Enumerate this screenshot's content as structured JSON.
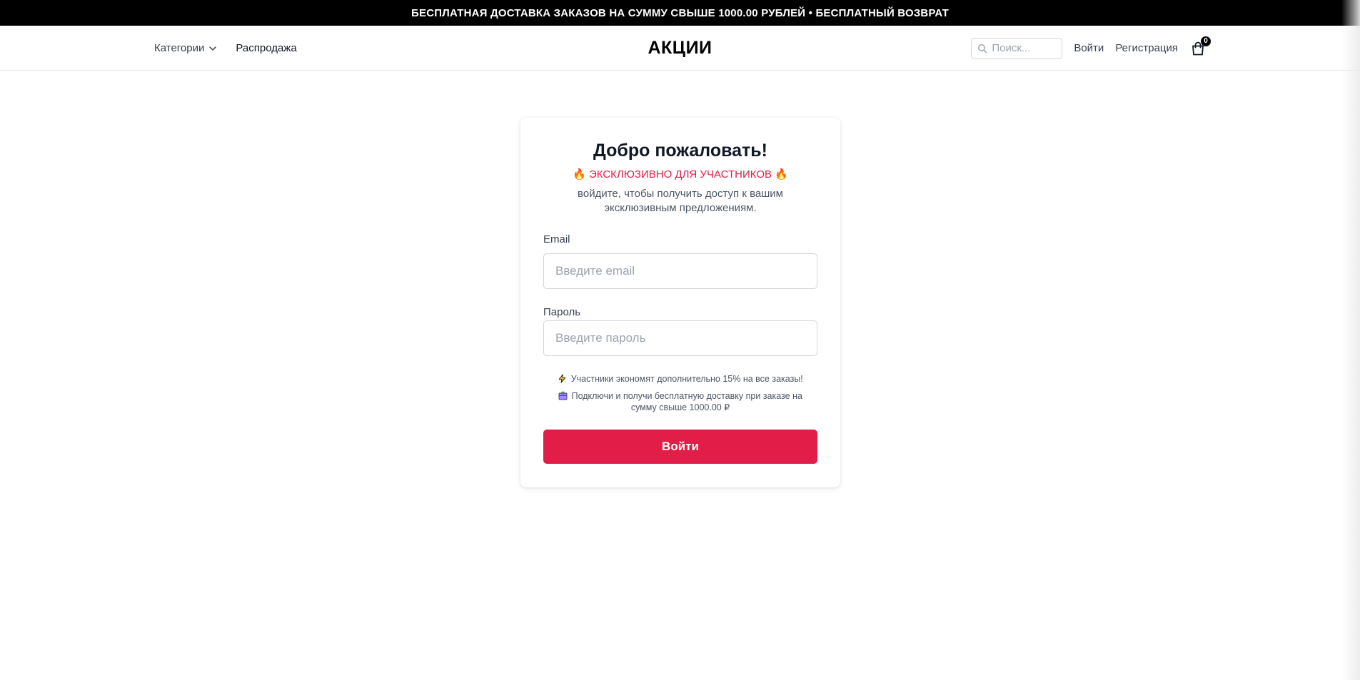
{
  "promo": {
    "text": "БЕСПЛАТНАЯ ДОСТАВКА ЗАКАЗОВ НА СУММУ СВЫШЕ 1000.00 РУБЛЕЙ • БЕСПЛАТНЫЙ ВОЗВРАТ"
  },
  "header": {
    "categories_label": "Категории",
    "sale_label": "Распродажа",
    "brand": "АКЦИИ",
    "search_placeholder": "Поиск...",
    "login_label": "Войти",
    "register_label": "Регистрация",
    "cart_count": "0"
  },
  "login": {
    "title": "Добро пожаловать!",
    "exclusive": "ЭКСКЛЮЗИВНО ДЛЯ УЧАСТНИКОВ",
    "exclusive_icon": "fire-icon",
    "subtitle": "войдите, чтобы получить доступ к вашим эксклюзивным предложениям.",
    "email_label": "Email",
    "email_placeholder": "Введите email",
    "password_label": "Пароль",
    "password_placeholder": "Введите пароль",
    "perk1": "Участники экономят дополнительно 15% на все заказы!",
    "perk1_icon": "lightning-icon",
    "perk2": "Подключи и получи бесплатную доставку при заказе на сумму свыше 1000.00 ₽",
    "perk2_icon": "package-icon",
    "submit_label": "Войти"
  },
  "colors": {
    "accent": "#e11d48",
    "promo_bg": "#000000"
  }
}
